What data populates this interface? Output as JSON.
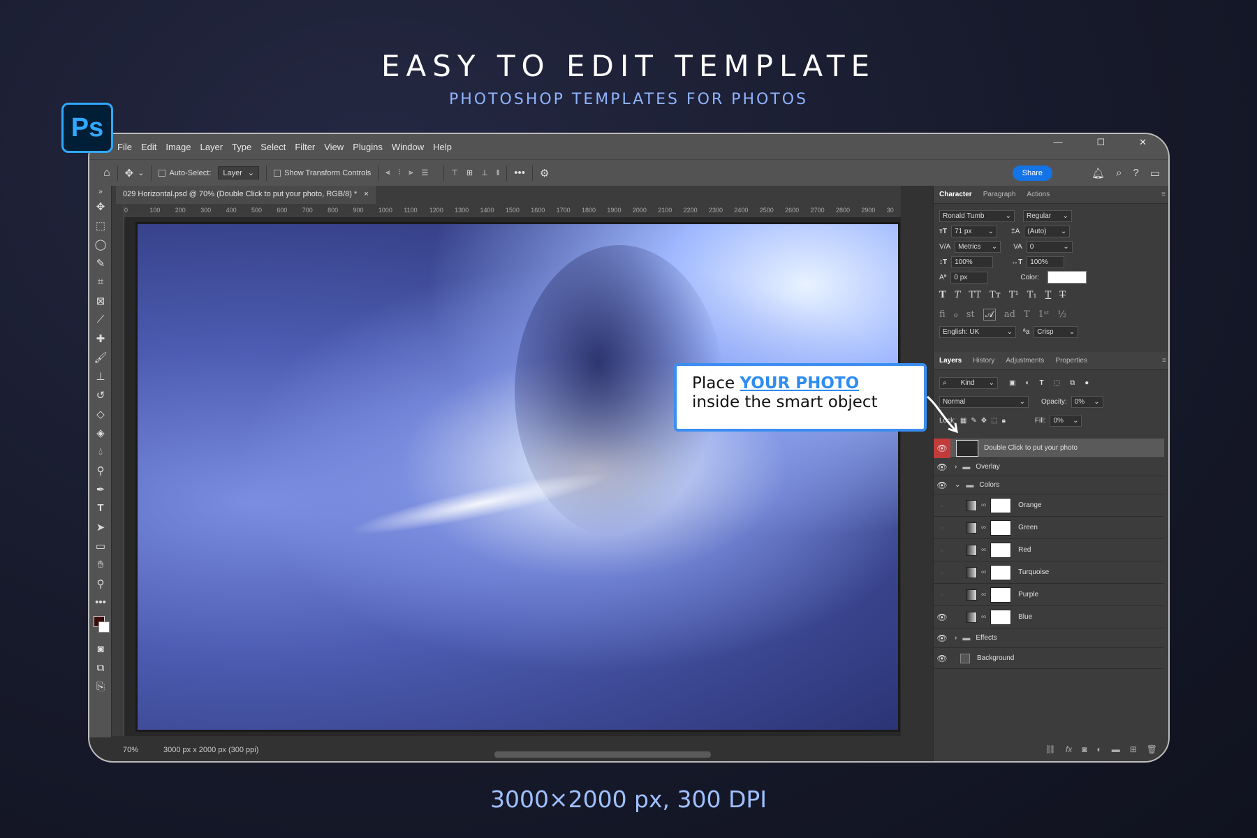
{
  "heading": "EASY TO EDIT TEMPLATE",
  "subheading": "PHOTOSHOP TEMPLATES FOR PHOTOS",
  "footer": "3000×2000 px, 300 DPI",
  "app_logo": "Ps",
  "menu": [
    "File",
    "Edit",
    "Image",
    "Layer",
    "Type",
    "Select",
    "Filter",
    "View",
    "Plugins",
    "Window",
    "Help"
  ],
  "options": {
    "auto_select": "Auto-Select:",
    "auto_select_value": "Layer",
    "transform": "Show Transform Controls",
    "share": "Share"
  },
  "document_tab": {
    "title": "029  Horizontal.psd @ 70% (Double Click to put your photo, RGB/8) *",
    "close": "×"
  },
  "ruler_ticks": [
    "0",
    "100",
    "200",
    "300",
    "400",
    "500",
    "600",
    "700",
    "800",
    "900",
    "1000",
    "1100",
    "1200",
    "1300",
    "1400",
    "1500",
    "1600",
    "1700",
    "1800",
    "1900",
    "2000",
    "2100",
    "2200",
    "2300",
    "2400",
    "2500",
    "2600",
    "2700",
    "2800",
    "2900",
    "30"
  ],
  "status": {
    "zoom": "70%",
    "size": "3000 px x 2000 px (300 ppi)"
  },
  "character_panel": {
    "tabs": [
      "Character",
      "Paragraph",
      "Actions"
    ],
    "font": "Ronald Tumb",
    "style": "Regular",
    "size": "71 px",
    "leading": "(Auto)",
    "kerning": "Metrics",
    "tracking": "0",
    "vscale": "100%",
    "hscale": "100%",
    "baseline": "0 px",
    "color_label": "Color:",
    "language": "English: UK",
    "antialias": "Crisp",
    "aa_label": "ªa"
  },
  "layers_panel": {
    "tabs": [
      "Layers",
      "History",
      "Adjustments",
      "Properties"
    ],
    "kind": "Kind",
    "blend": "Normal",
    "opacity_label": "Opacity:",
    "opacity": "0%",
    "lock_label": "Lock:",
    "fill_label": "Fill:",
    "fill": "0%",
    "layers": [
      {
        "name": "Double Click to put your photo",
        "visible": true
      },
      {
        "name": "Overlay",
        "visible": true
      },
      {
        "name": "Colors",
        "visible": true
      },
      {
        "name": "Orange",
        "visible": false
      },
      {
        "name": "Green",
        "visible": false
      },
      {
        "name": "Red",
        "visible": false
      },
      {
        "name": "Turquoise",
        "visible": false
      },
      {
        "name": "Purple",
        "visible": false
      },
      {
        "name": "Blue",
        "visible": true
      },
      {
        "name": "Effects",
        "visible": true
      },
      {
        "name": "Background",
        "visible": true
      }
    ]
  },
  "callout": {
    "prefix": "Place ",
    "highlight": "YOUR PHOTO",
    "line2": "inside the smart object"
  },
  "colors": {
    "accent": "#3b8ef0",
    "ps_blue": "#31a8ff",
    "share_blue": "#1473e6",
    "eye_active_bg": "#c23b3b"
  }
}
